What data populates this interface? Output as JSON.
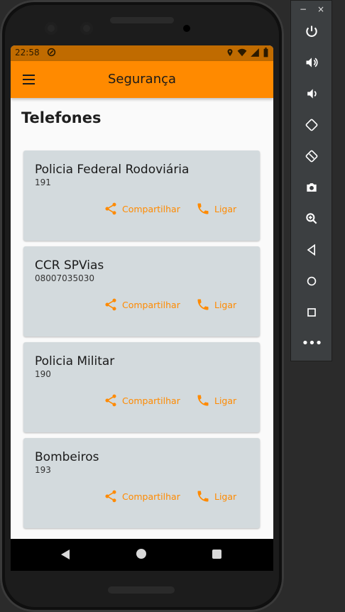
{
  "status_bar": {
    "time": "22:58"
  },
  "app_bar": {
    "title": "Segurança",
    "menu_icon": "menu-icon"
  },
  "page": {
    "heading": "Telefones"
  },
  "contacts": [
    {
      "name": "Policia Federal Rodoviária",
      "number": "191",
      "share_label": "Compartilhar",
      "call_label": "Ligar"
    },
    {
      "name": "CCR SPVias",
      "number": "08007035030",
      "share_label": "Compartilhar",
      "call_label": "Ligar"
    },
    {
      "name": "Policia Militar",
      "number": "190",
      "share_label": "Compartilhar",
      "call_label": "Ligar"
    },
    {
      "name": "Bombeiros",
      "number": "193",
      "share_label": "Compartilhar",
      "call_label": "Ligar"
    }
  ],
  "emulator_toolbar": {
    "minimize": "−",
    "close": "×",
    "buttons": [
      "power-icon",
      "volume-up-icon",
      "volume-down-icon",
      "rotate-left-icon",
      "rotate-right-icon",
      "camera-icon",
      "zoom-icon",
      "back-icon",
      "home-icon",
      "overview-icon",
      "more-icon"
    ],
    "more": "•••"
  },
  "colors": {
    "accent": "#ff8a00",
    "status_bar": "#c06b00",
    "card": "#d3dadd"
  }
}
